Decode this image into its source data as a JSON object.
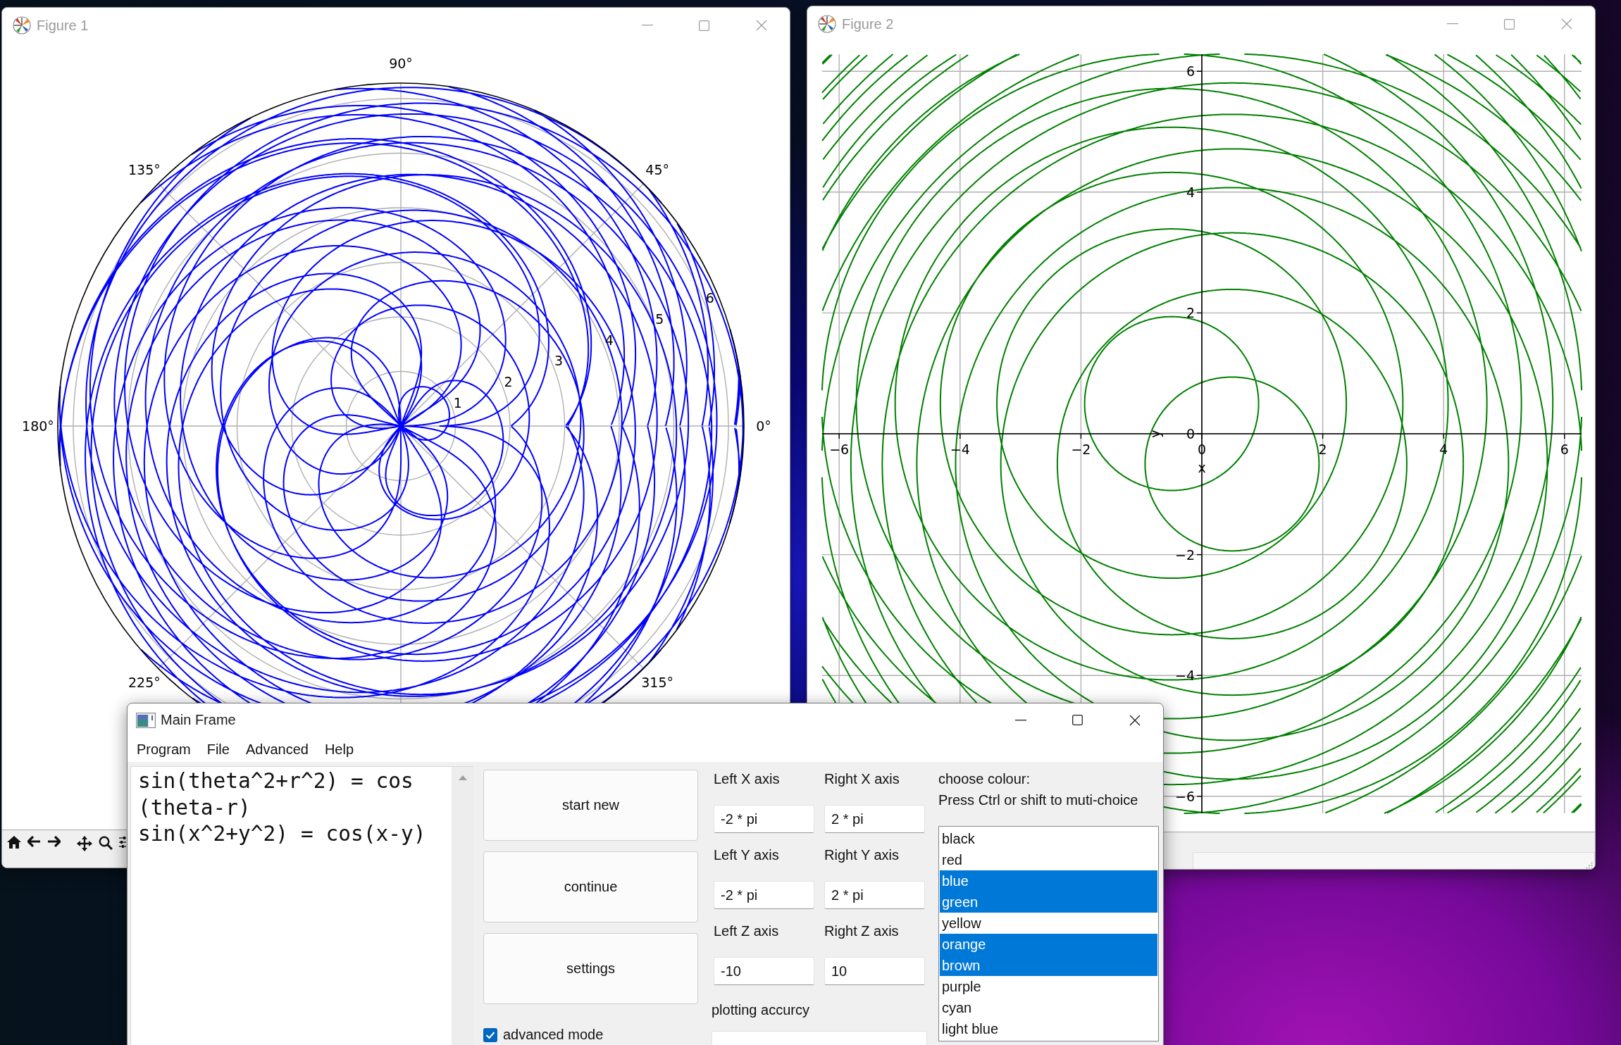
{
  "figures": [
    {
      "title": "Figure 1",
      "kind": "polar",
      "color": "#0000ff",
      "angle_labels": [
        "0°",
        "45°",
        "90°",
        "135°",
        "180°",
        "225°",
        "315°"
      ],
      "radius_labels": [
        "1",
        "2",
        "3",
        "4",
        "5",
        "6"
      ]
    },
    {
      "title": "Figure 2",
      "kind": "cartesian",
      "color": "#008000",
      "x_tick_labels": [
        "−6",
        "−4",
        "−2",
        "0",
        "2",
        "4",
        "6"
      ],
      "y_tick_labels": [
        "6",
        "4",
        "2",
        "0",
        "−2",
        "−4",
        "−6"
      ],
      "xlabel": "x",
      "ylabel": "y"
    }
  ],
  "main_frame": {
    "title": "Main Frame",
    "menu": [
      "Program",
      "File",
      "Advanced",
      "Help"
    ],
    "editor_lines": [
      "sin(theta^2+r^2) = cos",
      "(theta-r)",
      "sin(x^2+y^2) = cos(x-y)"
    ],
    "buttons": [
      "start new",
      "continue",
      "settings"
    ],
    "advanced_mode": {
      "label": "advanced mode",
      "checked": true
    },
    "axis_fields": [
      {
        "label": "Left X axis",
        "value": "-2 * pi"
      },
      {
        "label": "Right X axis",
        "value": "2 * pi"
      },
      {
        "label": "Left Y axis",
        "value": "-2 * pi"
      },
      {
        "label": "Right Y axis",
        "value": "2 * pi"
      },
      {
        "label": "Left Z axis",
        "value": "-10"
      },
      {
        "label": "Right Z axis",
        "value": "10"
      }
    ],
    "accuracy": {
      "label": "plotting accurcy"
    },
    "colour": {
      "title": "choose colour:",
      "hint": "Press Ctrl or shift to muti-choice",
      "options": [
        {
          "label": "black",
          "selected": false
        },
        {
          "label": "red",
          "selected": false
        },
        {
          "label": "blue",
          "selected": true
        },
        {
          "label": "green",
          "selected": true
        },
        {
          "label": "yellow",
          "selected": false
        },
        {
          "label": "orange",
          "selected": true
        },
        {
          "label": "brown",
          "selected": true
        },
        {
          "label": "purple",
          "selected": false
        },
        {
          "label": "cyan",
          "selected": false
        },
        {
          "label": "light blue",
          "selected": false
        }
      ]
    }
  }
}
